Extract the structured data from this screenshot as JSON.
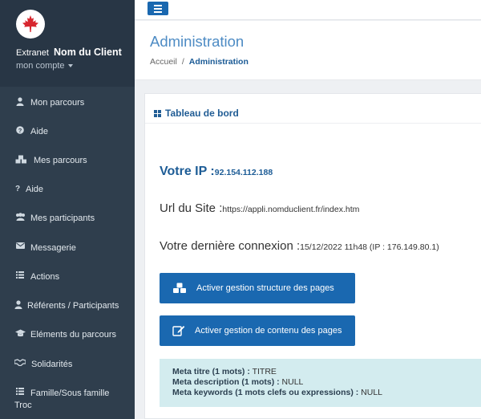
{
  "sidebar": {
    "brand_prefix": "Extranet",
    "client_name": "Nom du Client",
    "account_label": "mon compte",
    "items": [
      {
        "label": "Mon parcours",
        "icon": "user-icon"
      },
      {
        "label": "Aide",
        "icon": "question-circle-icon"
      },
      {
        "label": "Mes parcours",
        "icon": "cubes-icon"
      },
      {
        "label": "Aide",
        "icon": "question-icon"
      },
      {
        "label": "Mes participants",
        "icon": "users-icon"
      },
      {
        "label": "Messagerie",
        "icon": "envelope-icon"
      },
      {
        "label": "Actions",
        "icon": "list-icon"
      },
      {
        "label": "Référents / Participants",
        "icon": "user-icon"
      },
      {
        "label": "Eléments du parcours",
        "icon": "graduation-cap-icon"
      },
      {
        "label": "Solidarités",
        "icon": "handshake-icon"
      },
      {
        "label": "Famille/Sous famille",
        "label2": "Troc",
        "icon": "list-icon"
      }
    ]
  },
  "header": {
    "title": "Administration",
    "breadcrumb_home": "Accueil",
    "breadcrumb_sep": "/",
    "breadcrumb_current": "Administration"
  },
  "panel": {
    "title": "Tableau de bord",
    "ip_label": "Votre IP :",
    "ip_value": "92.154.112.188",
    "url_label": "Url du Site :",
    "url_value": "https://appli.nomduclient.fr/index.htm",
    "last_login_label": "Votre dernière connexion :",
    "last_login_value": "15/12/2022 11h48 (IP : 176.149.80.1)",
    "btn_structure": "Activer gestion structure des pages",
    "btn_content": "Activer gestion de contenu des pages",
    "meta_title_label": "Meta titre (1 mots) :",
    "meta_title_value": " TITRE",
    "meta_desc_label": "Meta description (1 mots) :",
    "meta_desc_value": " NULL",
    "meta_kw_label": "Meta keywords (1 mots clefs ou expressions) :",
    "meta_kw_value": " NULL"
  },
  "colors": {
    "sidebar_bg": "#2f3e4d",
    "accent": "#1a68b0",
    "title_blue": "#4d8bc4",
    "meta_bg": "#d3ecef",
    "logo_red": "#d7262e"
  }
}
